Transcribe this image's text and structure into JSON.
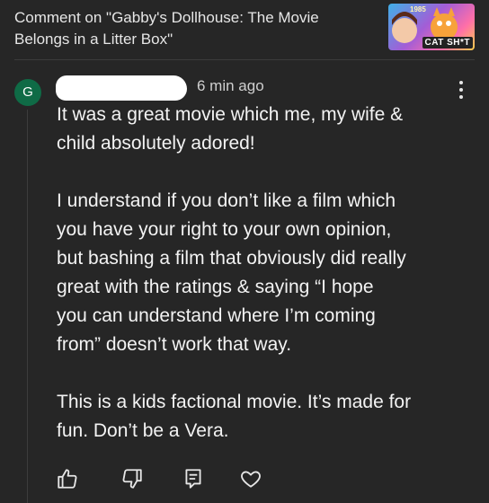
{
  "header": {
    "title": "Comment on \"Gabby's Dollhouse: The Movie Belongs in a Litter Box\"",
    "thumbnail": {
      "year_text": "1985",
      "brand_text": "CAT SH*T"
    }
  },
  "comment": {
    "avatar_letter": "G",
    "avatar_color": "#0f6b46",
    "timestamp": "6 min ago",
    "paragraphs": [
      "It was a great movie which me, my wife &\nchild absolutely adored!",
      "I understand if you don’t like a film which\nyou have your right to your own opinion,\nbut bashing a film that obviously did really\ngreat with the ratings & saying “I hope\nyou can understand where I’m coming\nfrom” doesn’t work that way.",
      "This is a kids factional movie. It’s made for\nfun. Don’t be a Vera."
    ]
  },
  "actions": {
    "icons": [
      "thumbs-up-icon",
      "thumbs-down-icon",
      "reply-icon",
      "heart-icon"
    ]
  },
  "colors": {
    "background": "#262626",
    "text": "#f1f1f1",
    "muted": "#cfcfcf"
  }
}
